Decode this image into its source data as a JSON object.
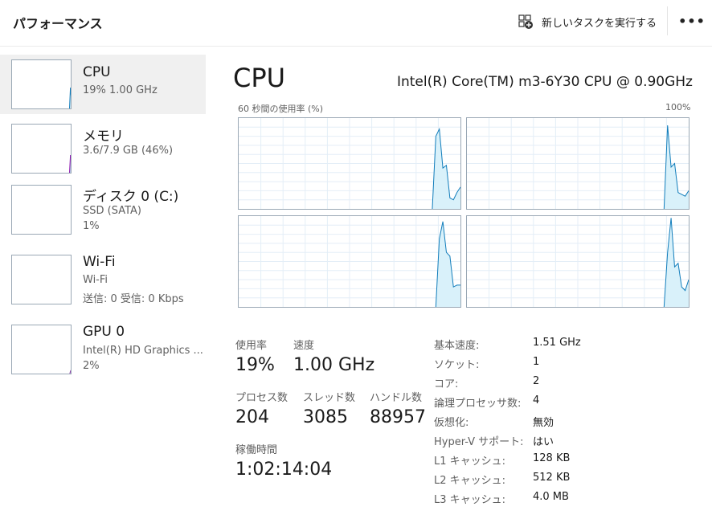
{
  "header": {
    "title": "パフォーマンス",
    "run_task_label": "新しいタスクを実行する",
    "more_label": "•••"
  },
  "sidebar": {
    "items": [
      {
        "title": "CPU",
        "sub1": "19%  1.00 GHz",
        "sub2": ""
      },
      {
        "title": "メモリ",
        "sub1": "3.6/7.9 GB (46%)",
        "sub2": ""
      },
      {
        "title": "ディスク 0 (C:)",
        "sub1": "SSD (SATA)",
        "sub2": "1%"
      },
      {
        "title": "Wi-Fi",
        "sub1": "Wi-Fi",
        "sub2": "送信: 0  受信: 0 Kbps"
      },
      {
        "title": "GPU 0",
        "sub1": "Intel(R) HD Graphics ...",
        "sub2": "2%"
      }
    ]
  },
  "main": {
    "title": "CPU",
    "cpu_name": "Intel(R) Core(TM) m3-6Y30 CPU @ 0.90GHz",
    "graph_caption": "60 秒間の使用率 (%)",
    "graph_max": "100%"
  },
  "stats": {
    "usage_label": "使用率",
    "usage_value": "19%",
    "speed_label": "速度",
    "speed_value": "1.00 GHz",
    "processes_label": "プロセス数",
    "processes_value": "204",
    "threads_label": "スレッド数",
    "threads_value": "3085",
    "handles_label": "ハンドル数",
    "handles_value": "88957",
    "uptime_label": "稼働時間",
    "uptime_value": "1:02:14:04"
  },
  "specs": [
    {
      "label": "基本速度:",
      "value": "1.51 GHz"
    },
    {
      "label": "ソケット:",
      "value": "1"
    },
    {
      "label": "コア:",
      "value": "2"
    },
    {
      "label": "論理プロセッサ数:",
      "value": "4"
    },
    {
      "label": "仮想化:",
      "value": "無効"
    },
    {
      "label": "Hyper-V サポート:",
      "value": "はい"
    },
    {
      "label": "L1 キャッシュ:",
      "value": "128 KB"
    },
    {
      "label": "L2 キャッシュ:",
      "value": "512 KB"
    },
    {
      "label": "L3 キャッシュ:",
      "value": "4.0 MB"
    }
  ],
  "colors": {
    "cpu_line": "#117dbb",
    "cpu_fill": "#d9f1fa",
    "memory_line": "#8b12ae",
    "memory_fill": "#bfd9f1",
    "gpu_line": "#8e44ad",
    "grid": "#e4eef7",
    "border": "#9aa8b5"
  },
  "chart_data": [
    {
      "type": "area",
      "series": [
        {
          "values": [
            0,
            0,
            0,
            0,
            0,
            0,
            0,
            0,
            0,
            0,
            0,
            0,
            0,
            0,
            0,
            0,
            0,
            0,
            0,
            0,
            0,
            0,
            0,
            0,
            0,
            0,
            0,
            0,
            0,
            0,
            0,
            0,
            0,
            0,
            0,
            0,
            0,
            0,
            0,
            0,
            0,
            0,
            0,
            0,
            0,
            0,
            0,
            0,
            0,
            0,
            0,
            0,
            0,
            0,
            0,
            0,
            80,
            88,
            45,
            48,
            12,
            10,
            18,
            24
          ]
        }
      ],
      "ylim": [
        0,
        100
      ]
    },
    {
      "type": "area",
      "series": [
        {
          "values": [
            0,
            0,
            0,
            0,
            0,
            0,
            0,
            0,
            0,
            0,
            0,
            0,
            0,
            0,
            0,
            0,
            0,
            0,
            0,
            0,
            0,
            0,
            0,
            0,
            0,
            0,
            0,
            0,
            0,
            0,
            0,
            0,
            0,
            0,
            0,
            0,
            0,
            0,
            0,
            0,
            0,
            0,
            0,
            0,
            0,
            0,
            0,
            0,
            0,
            0,
            0,
            0,
            0,
            0,
            0,
            0,
            0,
            92,
            46,
            50,
            18,
            16,
            14,
            20
          ]
        }
      ],
      "ylim": [
        0,
        100
      ]
    },
    {
      "type": "area",
      "series": [
        {
          "values": [
            0,
            0,
            0,
            0,
            0,
            0,
            0,
            0,
            0,
            0,
            0,
            0,
            0,
            0,
            0,
            0,
            0,
            0,
            0,
            0,
            0,
            0,
            0,
            0,
            0,
            0,
            0,
            0,
            0,
            0,
            0,
            0,
            0,
            0,
            0,
            0,
            0,
            0,
            0,
            0,
            0,
            0,
            0,
            0,
            0,
            0,
            0,
            0,
            0,
            0,
            0,
            0,
            0,
            0,
            0,
            0,
            0,
            75,
            94,
            60,
            56,
            22,
            24,
            24
          ]
        }
      ],
      "ylim": [
        0,
        100
      ]
    },
    {
      "type": "area",
      "series": [
        {
          "values": [
            0,
            0,
            0,
            0,
            0,
            0,
            0,
            0,
            0,
            0,
            0,
            0,
            0,
            0,
            0,
            0,
            0,
            0,
            0,
            0,
            0,
            0,
            0,
            0,
            0,
            0,
            0,
            0,
            0,
            0,
            0,
            0,
            0,
            0,
            0,
            0,
            0,
            0,
            0,
            0,
            0,
            0,
            0,
            0,
            0,
            0,
            0,
            0,
            0,
            0,
            0,
            0,
            0,
            0,
            0,
            0,
            0,
            60,
            98,
            44,
            48,
            22,
            18,
            30
          ]
        }
      ],
      "ylim": [
        0,
        100
      ]
    }
  ],
  "thumbs": {
    "cpu": [
      0,
      0,
      0,
      0,
      0,
      0,
      0,
      0,
      0,
      0,
      0,
      0,
      0,
      0,
      0,
      0,
      0,
      0,
      0,
      0,
      0,
      0,
      0,
      0,
      0,
      0,
      0,
      0,
      0,
      0,
      0,
      0,
      0,
      0,
      0,
      0,
      0,
      0,
      0,
      0,
      0,
      0,
      0,
      0,
      0,
      0,
      0,
      0,
      0,
      0,
      0,
      0,
      0,
      0,
      0,
      0,
      0,
      0,
      0,
      0,
      0,
      45,
      22,
      18
    ],
    "memory": [
      0,
      0,
      0,
      0,
      0,
      0,
      0,
      0,
      0,
      0,
      0,
      0,
      0,
      0,
      0,
      0,
      0,
      0,
      0,
      0,
      0,
      0,
      0,
      0,
      0,
      0,
      0,
      0,
      0,
      0,
      0,
      0,
      0,
      0,
      0,
      0,
      0,
      0,
      0,
      0,
      0,
      0,
      0,
      0,
      0,
      0,
      0,
      0,
      0,
      0,
      0,
      0,
      0,
      0,
      0,
      0,
      0,
      0,
      0,
      0,
      0,
      38,
      38,
      38
    ],
    "gpu": [
      0,
      0,
      0,
      0,
      0,
      0,
      0,
      0,
      0,
      0,
      0,
      0,
      0,
      0,
      0,
      0,
      0,
      0,
      0,
      0,
      0,
      0,
      0,
      0,
      0,
      0,
      0,
      0,
      0,
      0,
      0,
      0,
      0,
      0,
      0,
      0,
      0,
      0,
      0,
      0,
      0,
      0,
      0,
      0,
      0,
      0,
      0,
      0,
      0,
      0,
      0,
      0,
      0,
      0,
      0,
      0,
      0,
      0,
      0,
      0,
      0,
      8,
      4,
      3
    ]
  }
}
